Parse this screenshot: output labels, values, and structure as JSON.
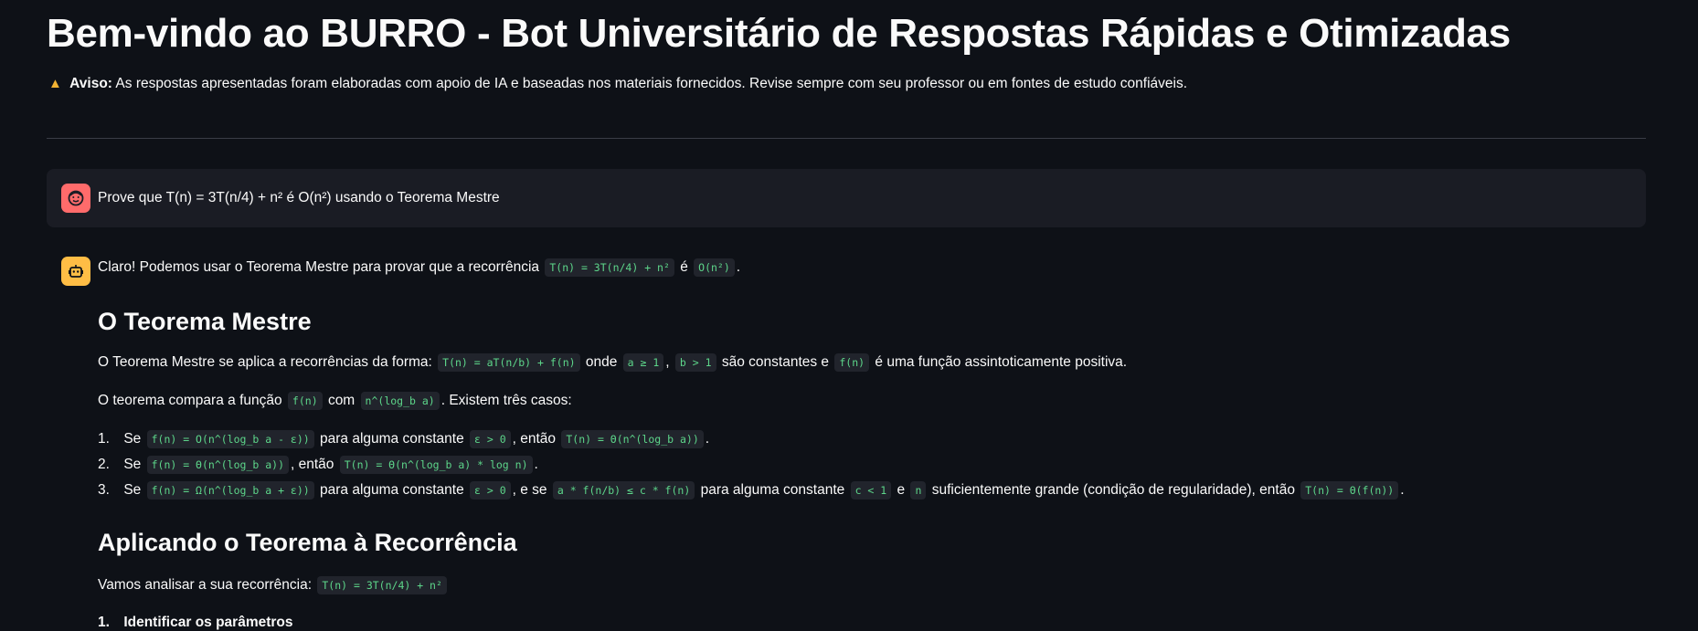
{
  "header": {
    "title": "Bem-vindo ao BURRO - Bot Universitário de Respostas Rápidas e Otimizadas",
    "warning_label": "Aviso:",
    "warning_text": "As respostas apresentadas foram elaboradas com apoio de IA e baseadas nos materiais fornecidos. Revise sempre com seu professor ou em fontes de estudo confiáveis."
  },
  "user_message": {
    "text": "Prove que T(n) = 3T(n/4) + n² é O(n²) usando o Teorema Mestre"
  },
  "bot_message": {
    "intro": {
      "t1": "Claro! Podemos usar o Teorema Mestre para provar que a recorrência",
      "c1": "T(n) = 3T(n/4) + n²",
      "t2": "é",
      "c2": "O(n²)",
      "t3": "."
    },
    "section1_title": "O Teorema Mestre",
    "p1": {
      "t1": "O Teorema Mestre se aplica a recorrências da forma:",
      "c1": "T(n) = aT(n/b) + f(n)",
      "t2": "onde",
      "c2": "a ≥ 1",
      "t3": ",",
      "c3": "b > 1",
      "t4": "são constantes e",
      "c4": "f(n)",
      "t5": "é uma função assintoticamente positiva."
    },
    "p2": {
      "t1": "O teorema compara a função",
      "c1": "f(n)",
      "t2": "com",
      "c2": "n^(log_b a)",
      "t3": ". Existem três casos:"
    },
    "cases": [
      {
        "num": "1.",
        "t1": "Se",
        "c1": "f(n) = O(n^(log_b a - ε))",
        "t2": "para alguma constante",
        "c2": "ε > 0",
        "t3": ", então",
        "c3": "T(n) = Θ(n^(log_b a))",
        "t4": "."
      },
      {
        "num": "2.",
        "t1": "Se",
        "c1": "f(n) = Θ(n^(log_b a))",
        "t2": ", então",
        "c2": "T(n) = Θ(n^(log_b a) * log n)",
        "t3": "."
      },
      {
        "num": "3.",
        "t1": "Se",
        "c1": "f(n) = Ω(n^(log_b a + ε))",
        "t2": "para alguma constante",
        "c2": "ε > 0",
        "t3": ", e se",
        "c3": "a * f(n/b) ≤ c * f(n)",
        "t4": "para alguma constante",
        "c4": "c < 1",
        "t5": "e",
        "c5": "n",
        "t6": "suficientemente grande (condição de regularidade), então",
        "c6": "T(n) = Θ(f(n))",
        "t7": "."
      }
    ],
    "section2_title": "Aplicando o Teorema à Recorrência",
    "p3": {
      "t1": "Vamos analisar a sua recorrência:",
      "c1": "T(n) = 3T(n/4) + n²"
    },
    "partial_item": {
      "num": "1.",
      "text": "Identificar os parâmetros"
    }
  },
  "icons": {
    "warning": "warning-icon",
    "user_avatar": "user-face-icon",
    "bot_avatar": "robot-icon"
  },
  "colors": {
    "background": "#0e1117",
    "user_avatar": "#ff6b6b",
    "bot_avatar": "#ffbd45",
    "code_text": "#5dd68a",
    "warning": "#f2b233"
  }
}
